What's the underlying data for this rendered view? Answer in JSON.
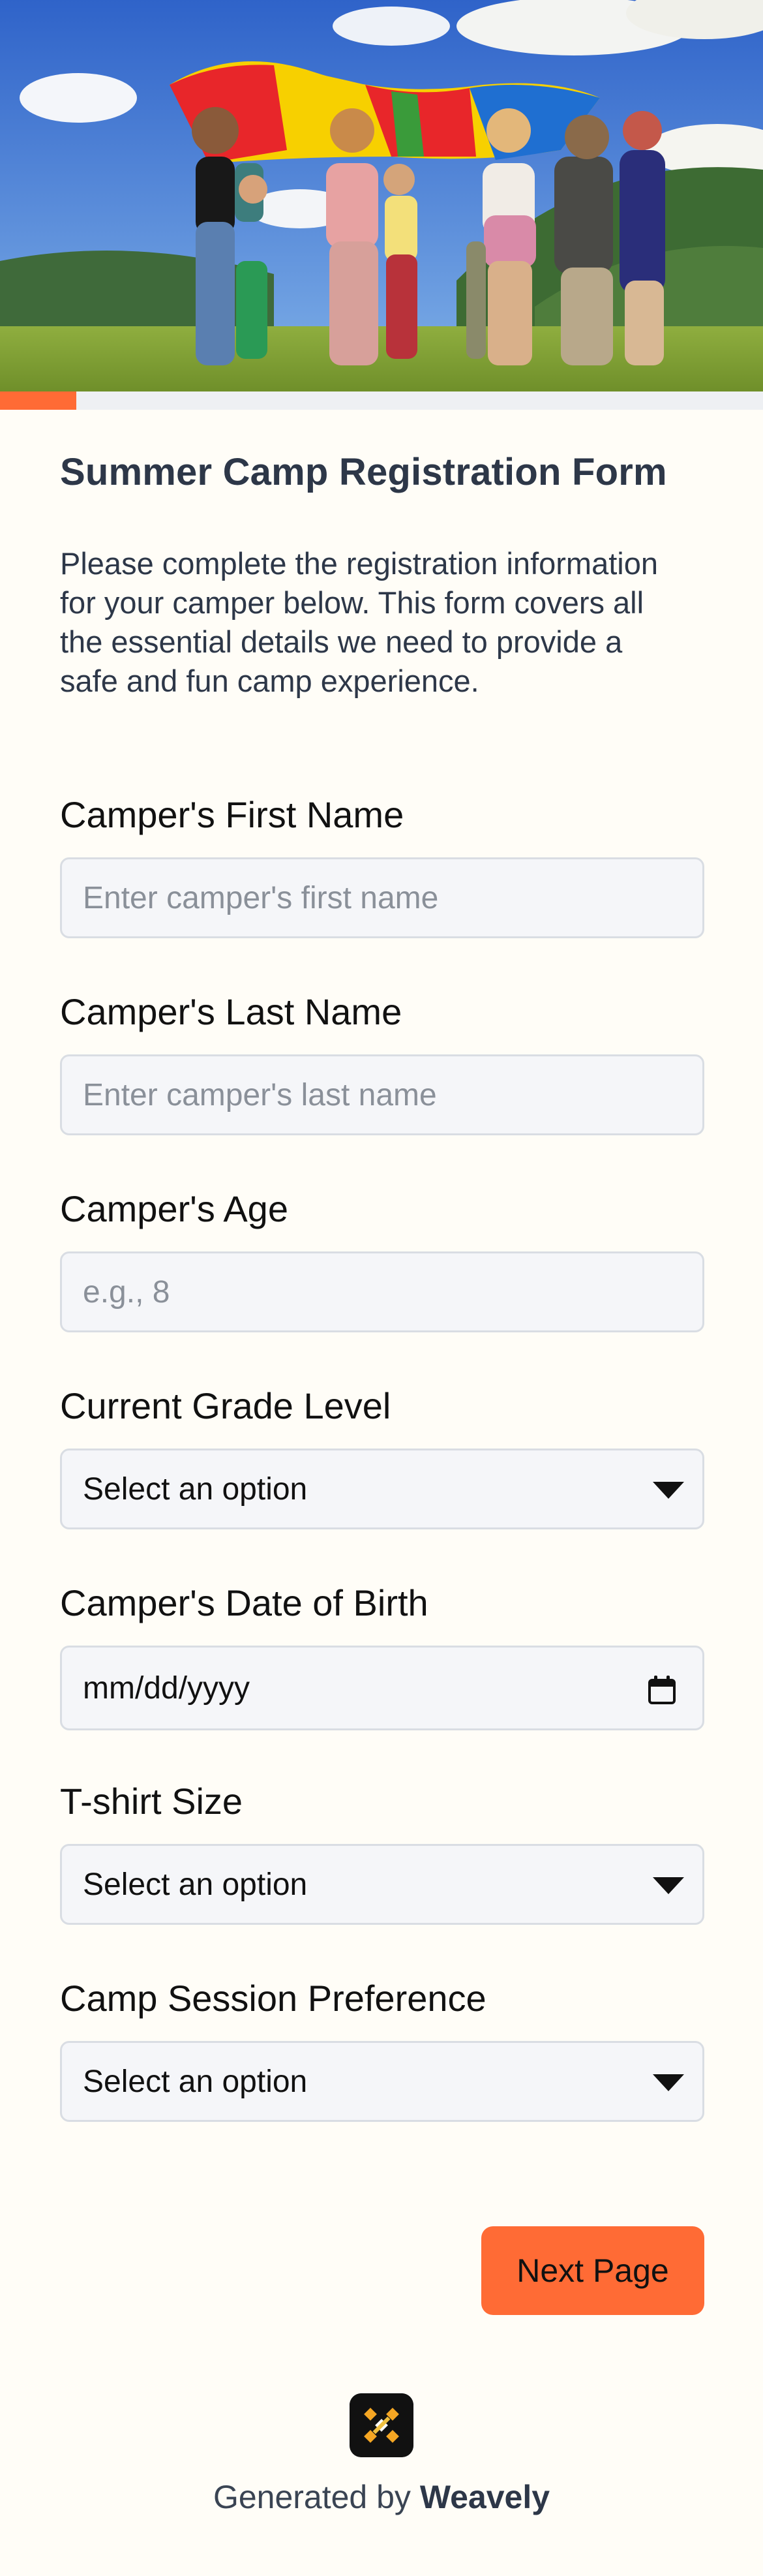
{
  "progress": {
    "fraction": 0.1
  },
  "form": {
    "title": "Summer Camp Registration Form",
    "description": "Please complete the registration information for your camper below. This form covers all the essential details we need to provide a safe and fun camp experience."
  },
  "fields": {
    "first_name": {
      "label": "Camper's First Name",
      "placeholder": "Enter camper's first name"
    },
    "last_name": {
      "label": "Camper's Last Name",
      "placeholder": "Enter camper's last name"
    },
    "age": {
      "label": "Camper's Age",
      "placeholder": "e.g., 8"
    },
    "grade": {
      "label": "Current Grade Level",
      "value": "Select an option"
    },
    "dob": {
      "label": "Camper's Date of Birth",
      "value": "mm/dd/yyyy"
    },
    "tshirt": {
      "label": "T-shirt Size",
      "value": "Select an option"
    },
    "session": {
      "label": "Camp Session Preference",
      "value": "Select an option"
    }
  },
  "actions": {
    "next_label": "Next Page"
  },
  "footer": {
    "prefix": "Generated by",
    "brand": "Weavely"
  },
  "colors": {
    "accent": "#ff6b35",
    "background": "#fffdf7",
    "field_bg": "#f5f6f9"
  },
  "icons": {
    "dropdown": "chevron-down-icon",
    "date": "calendar-icon",
    "logo": "weavely-logo-icon"
  }
}
